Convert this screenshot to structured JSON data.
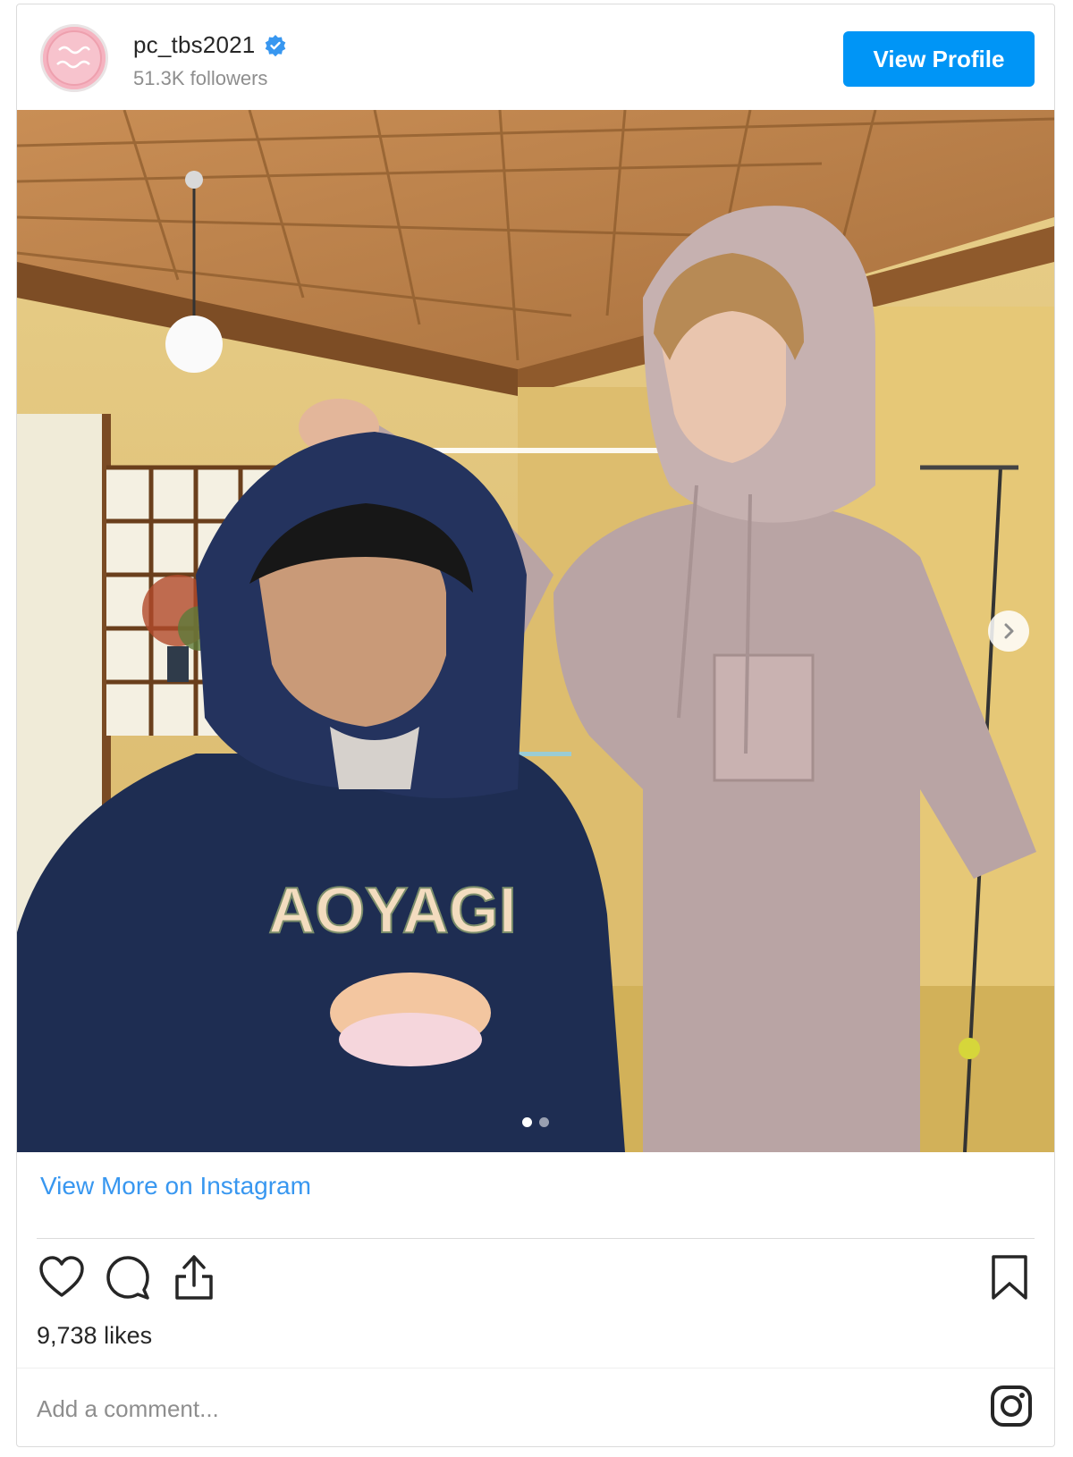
{
  "header": {
    "username": "pc_tbs2021",
    "followers": "51.3K followers",
    "view_profile_label": "View Profile",
    "verified_color": "#3897f0"
  },
  "post": {
    "sweatshirt_text": "AOYAGI",
    "carousel": {
      "total": 2,
      "current": 1
    }
  },
  "footer": {
    "view_more_label": "View More on Instagram",
    "likes": "9,738 likes",
    "comment_placeholder": "Add a comment..."
  },
  "icons": {
    "like": "heart-icon",
    "comment": "comment-icon",
    "share": "share-icon",
    "save": "bookmark-icon",
    "logo": "instagram-icon",
    "next": "chevron-right-icon"
  },
  "colors": {
    "accent": "#0095f6",
    "link": "#3897f0"
  }
}
